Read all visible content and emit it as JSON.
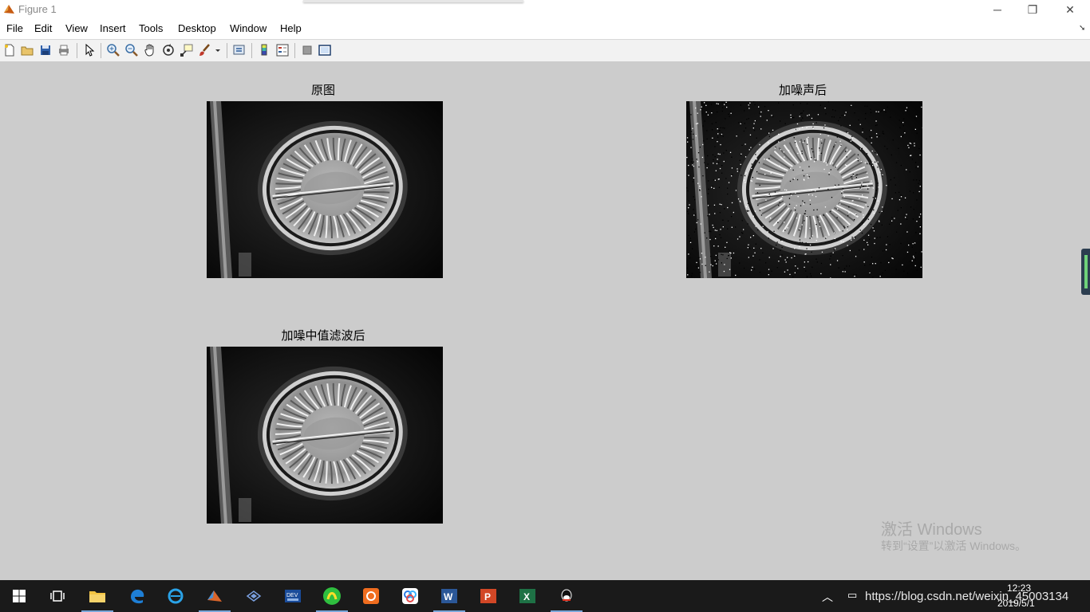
{
  "window": {
    "title": "Figure 1",
    "controls": {
      "minimize": "─",
      "restore": "❐",
      "close": "✕"
    }
  },
  "menu": {
    "file": "File",
    "edit": "Edit",
    "view": "View",
    "insert": "Insert",
    "tools": "Tools",
    "desktop": "Desktop",
    "window": "Window",
    "help": "Help"
  },
  "toolbar_icons": [
    "new-figure-icon",
    "open-icon",
    "save-icon",
    "print-icon",
    "edit-plot-arrow-icon",
    "zoom-in-icon",
    "zoom-out-icon",
    "pan-hand-icon",
    "rotate-3d-icon",
    "data-cursor-icon",
    "brush-icon",
    "link-plot-icon",
    "colorbar-icon",
    "legend-icon",
    "hide-plot-tools-icon",
    "show-plot-tools-icon"
  ],
  "axes": [
    {
      "title": "原图",
      "noise": false
    },
    {
      "title": "加噪声后",
      "noise": true
    },
    {
      "title": "加噪中值滤波后",
      "noise": false
    }
  ],
  "activation_watermark": {
    "line1": "激活 Windows",
    "line2": "转到“设置”以激活 Windows。"
  },
  "taskbar": {
    "apps": [
      "start-icon",
      "task-view-icon",
      "file-explorer-icon",
      "edge-icon",
      "ie-icon",
      "matlab-icon",
      "visual-studio-icon",
      "dev-cpp-icon",
      "app-green-icon",
      "app-orange-icon",
      "baidu-netdisk-icon",
      "word-icon",
      "powerpoint-icon",
      "excel-icon",
      "qq-icon"
    ],
    "url_overlay": "https://blog.csdn.net/weixin_45003134",
    "clock_time": "12:23",
    "clock_date": "2019/5/1"
  },
  "colors": {
    "figure_bg": "#cccccc",
    "taskbar_bg": "#1a1a1a",
    "title_text": "#8a8a8a"
  }
}
